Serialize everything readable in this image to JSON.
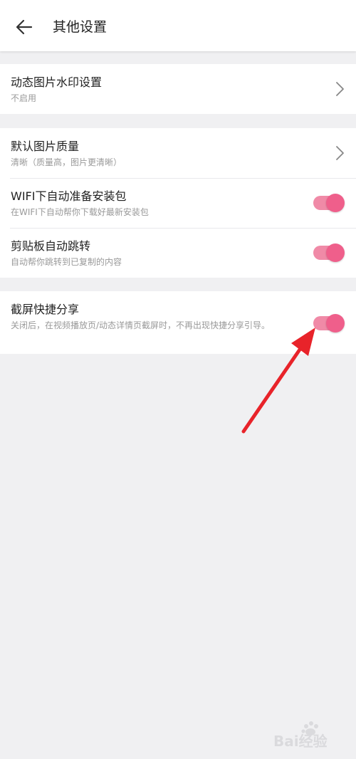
{
  "header": {
    "title": "其他设置"
  },
  "groups": [
    {
      "rows": [
        {
          "title": "动态图片水印设置",
          "subtitle": "不启用",
          "control": "chevron"
        }
      ]
    },
    {
      "rows": [
        {
          "title": "默认图片质量",
          "subtitle": "清晰（质量高，图片更清晰）",
          "control": "chevron"
        },
        {
          "title": "WIFI下自动准备安装包",
          "subtitle": "在WIFI下自动帮你下载好最新安装包",
          "control": "toggle",
          "on": true
        },
        {
          "title": "剪贴板自动跳转",
          "subtitle": "自动帮你跳转到已复制的内容",
          "control": "toggle",
          "on": true
        }
      ]
    },
    {
      "rows": [
        {
          "title": "截屏快捷分享",
          "subtitle": "关闭后，在视频播放页/动态详情页截屏时，不再出现快捷分享引导。",
          "control": "toggle",
          "on": true
        }
      ]
    }
  ],
  "watermark": {
    "text": "Bai经验"
  },
  "colors": {
    "accent": "#ef5f8b",
    "accent_track": "#f08aa7",
    "annotation_arrow": "#e8232a",
    "background": "#f0f0f2"
  }
}
